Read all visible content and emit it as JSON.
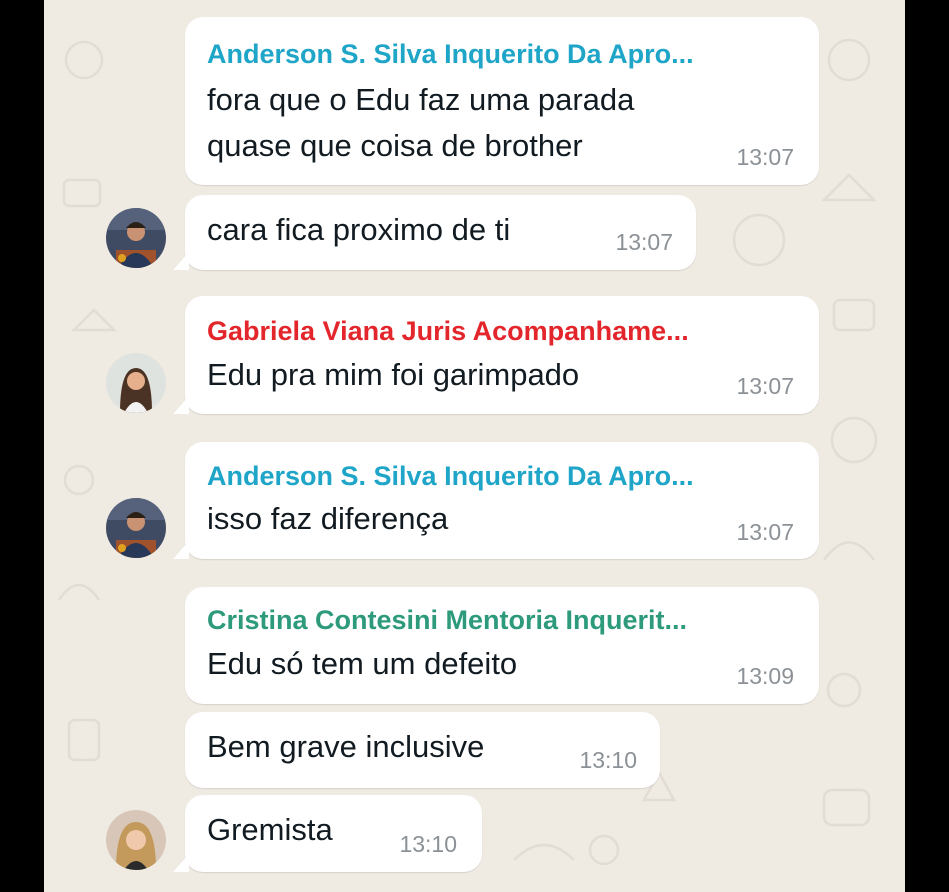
{
  "senders": {
    "anderson": {
      "name": "Anderson S. Silva Inquerito Da Apro...",
      "color": "#1fa5c8"
    },
    "gabriela": {
      "name": "Gabriela Viana Juris Acompanhame...",
      "color": "#e3262b"
    },
    "cristina": {
      "name": "Cristina Contesini Mentoria Inquerit...",
      "color": "#2d9a7c"
    }
  },
  "messages": [
    {
      "sender": "Anderson S. Silva Inquerito Da Apro...",
      "lines": [
        "fora que o Edu faz uma parada",
        "quase que coisa de brother"
      ],
      "time": "13:07"
    },
    {
      "lines": [
        "cara fica proximo de ti"
      ],
      "time": "13:07"
    },
    {
      "sender": "Gabriela Viana Juris Acompanhame...",
      "lines": [
        "Edu pra mim foi garimpado"
      ],
      "time": "13:07"
    },
    {
      "sender": "Anderson S. Silva Inquerito Da Apro...",
      "lines": [
        "isso faz diferença"
      ],
      "time": "13:07"
    },
    {
      "sender": "Cristina Contesini Mentoria Inquerit...",
      "lines": [
        "Edu só tem um defeito"
      ],
      "time": "13:09"
    },
    {
      "lines": [
        "Bem grave inclusive"
      ],
      "time": "13:10"
    },
    {
      "lines": [
        "Gremista"
      ],
      "time": "13:10"
    }
  ]
}
